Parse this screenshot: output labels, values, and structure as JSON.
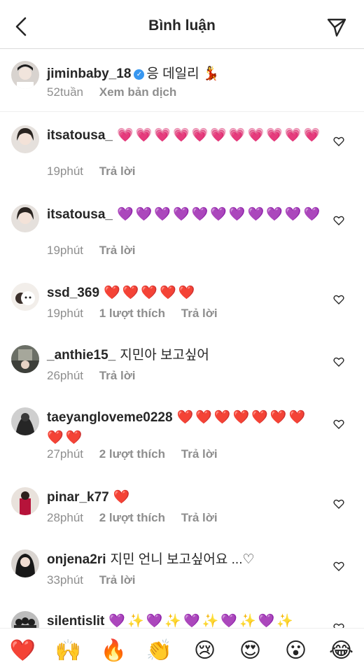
{
  "header": {
    "title": "Bình luận"
  },
  "caption": {
    "username": "jiminbaby_18",
    "text": "응 데일리",
    "emoji": "💃",
    "time": "52tuần",
    "see_translation": "Xem bản dịch"
  },
  "comments": [
    {
      "username": "itsatousa_",
      "text": "💗💗💗💗💗💗💗💗💗💗💗",
      "time": "19phút",
      "likes": "",
      "reply": "Trả lời"
    },
    {
      "username": "itsatousa_",
      "text": "💜💜💜💜💜💜💜💜💜💜💜",
      "time": "19phút",
      "likes": "",
      "reply": "Trả lời"
    },
    {
      "username": "ssd_369",
      "text": "❤️❤️❤️❤️❤️",
      "time": "19phút",
      "likes": "1 lượt thích",
      "reply": "Trả lời"
    },
    {
      "username": "_anthie15_",
      "text": "지민아 보고싶어",
      "time": "26phút",
      "likes": "",
      "reply": "Trả lời"
    },
    {
      "username": "taeyangloveme0228",
      "text": "❤️❤️❤️❤️❤️❤️❤️❤️❤️",
      "time": "27phút",
      "likes": "2 lượt thích",
      "reply": "Trả lời"
    },
    {
      "username": "pinar_k77",
      "text": "❤️",
      "time": "28phút",
      "likes": "2 lượt thích",
      "reply": "Trả lời"
    },
    {
      "username": "onjena2ri",
      "text": "지민 언니 보고싶어요 ...♡",
      "time": "33phút",
      "likes": "",
      "reply": "Trả lời"
    },
    {
      "username": "silentislit",
      "text": "💜✨💜✨💜✨💜✨💜✨",
      "time": "",
      "likes": "",
      "reply": ""
    }
  ],
  "reactions": [
    "❤️",
    "🙌",
    "🔥",
    "👏",
    "😢",
    "😍",
    "😮",
    "😂"
  ],
  "colors": {
    "accent": "#3897f0",
    "text": "#262626",
    "muted": "#8e8e8e",
    "divider": "#dbdbdb"
  }
}
